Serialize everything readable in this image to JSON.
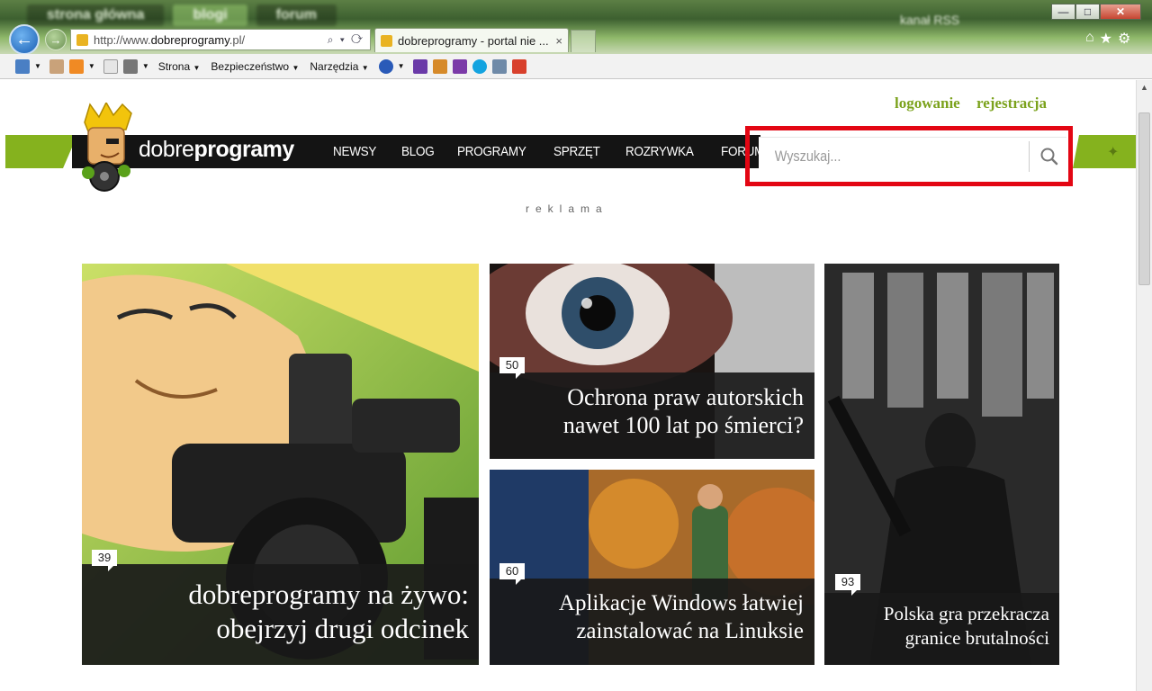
{
  "browser": {
    "bg_tabs": [
      "strona główna",
      "blogi",
      "forum"
    ],
    "bg_right": "kanał RSS",
    "address": {
      "prefix": "http://www.",
      "domain": "dobreprogramy",
      "suffix": ".pl/",
      "tools": "⌕ ▾ ⟳"
    },
    "tab_title": "dobreprogramy - portal nie ...",
    "tab_close": "×",
    "window_controls": {
      "minimize": "—",
      "maximize": "□",
      "close": "✕"
    },
    "chrome_icons": {
      "home": "⌂",
      "favorites": "★",
      "settings": "⚙"
    },
    "command_bar": {
      "menus": [
        "Strona",
        "Bezpieczeństwo",
        "Narzędzia"
      ]
    }
  },
  "site": {
    "user_links": {
      "login": "logowanie",
      "register": "rejestracja"
    },
    "brand": {
      "light": "dobre",
      "bold": "programy"
    },
    "nav": [
      "NEWSY",
      "BLOG",
      "PROGRAMY",
      "SPRZĘT",
      "ROZRYWKA",
      "FORUM"
    ],
    "search": {
      "placeholder": "Wyszukaj..."
    },
    "ad_label": "reklama",
    "right_accent_icon": "✦",
    "articles": [
      {
        "comments": "39",
        "title_lines": [
          "dobreprogramy na żywo:",
          "obejrzyj drugi odcinek"
        ]
      },
      {
        "comments": "50",
        "title_lines": [
          "Ochrona praw autorskich",
          "nawet 100 lat po śmierci?"
        ]
      },
      {
        "comments": "60",
        "title_lines": [
          "Aplikacje Windows łatwiej",
          "zainstalować na Linuksie"
        ]
      },
      {
        "comments": "93",
        "title_lines": [
          "Polska gra przekracza",
          "granice brutalności"
        ]
      }
    ]
  },
  "colors": {
    "brand_green": "#85b21e",
    "highlight_red": "#e30613",
    "nav_black": "#141414"
  }
}
